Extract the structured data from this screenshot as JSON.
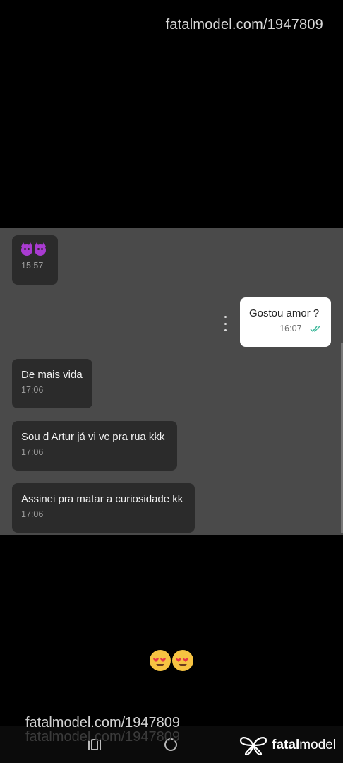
{
  "watermark": {
    "top": "fatalmodel.com/1947809",
    "bottom": "fatalmodel.com/1947809"
  },
  "messages": [
    {
      "direction": "incoming",
      "text": "😈😈",
      "time": "15:57"
    },
    {
      "direction": "outgoing",
      "text": "Gostou amor ?",
      "time": "16:07",
      "status": "read"
    },
    {
      "direction": "incoming",
      "text": "De mais vida",
      "time": "17:06"
    },
    {
      "direction": "incoming",
      "text": "Sou d Artur já vi vc pra rua kkk",
      "time": "17:06"
    },
    {
      "direction": "incoming",
      "text": "Assinei pra matar a curiosidade kk",
      "time": "17:06"
    }
  ],
  "caption_emojis": "😍😍",
  "brand": {
    "name_bold": "fatal",
    "name_rest": "model"
  },
  "icons": {
    "menu": "more-vertical-icon",
    "read": "double-check-icon",
    "recent": "recent-apps-icon",
    "home": "home-circle-icon",
    "logo": "butterfly-logo-icon"
  },
  "colors": {
    "chat_background": "#4a4a4a",
    "incoming_bubble": "#2b2b2b",
    "outgoing_bubble": "#ffffff",
    "read_check": "#3cb89a"
  }
}
